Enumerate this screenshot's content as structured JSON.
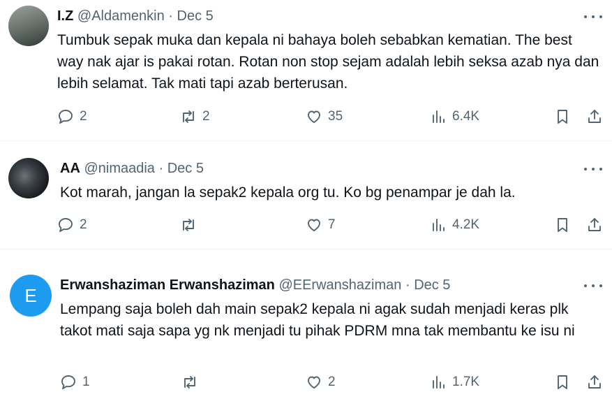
{
  "tweets": [
    {
      "name": "I.Z",
      "handle": "@Aldamenkin",
      "sep": "·",
      "date": "Dec 5",
      "text": "Tumbuk sepak muka dan kepala ni bahaya boleh sebabkan kematian. The best way nak ajar is pakai rotan. Rotan non stop sejam adalah lebih seksa azab nya dan lebih selamat. Tak mati tapi azab berterusan.",
      "replies": "2",
      "reposts": "2",
      "likes": "35",
      "views": "6.4K",
      "avatar_colors": [
        "#8a8f8b",
        "#3e4a45"
      ]
    },
    {
      "name": "AA",
      "handle": "@nimaadia",
      "sep": "·",
      "date": "Dec 5",
      "text": "Kot marah, jangan la sepak2 kepala org tu. Ko bg penampar je dah la.",
      "replies": "2",
      "reposts": "",
      "likes": "7",
      "views": "4.2K",
      "avatar_colors": [
        "#1b1f23",
        "#5a5f66"
      ]
    },
    {
      "name": "Erwanshaziman Erwanshaziman",
      "handle": "@EErwanshaziman",
      "sep": "·",
      "date": "Dec 5",
      "text": "Lempang saja boleh dah main sepak2 kepala ni agak sudah menjadi keras plk takot mati saja sapa yg nk menjadi tu pihak PDRM mna tak membantu ke isu ni",
      "replies": "1",
      "reposts": "",
      "likes": "2",
      "views": "1.7K",
      "avatar_letter": "E",
      "avatar_colors": [
        "#1d9bf0"
      ]
    }
  ]
}
